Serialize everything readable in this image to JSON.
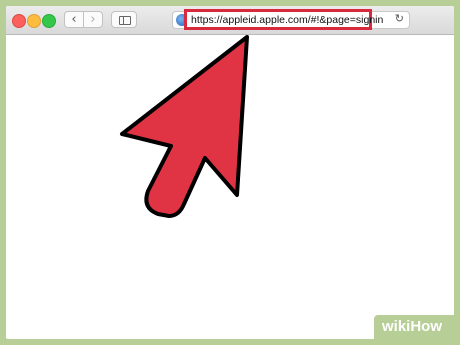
{
  "browser": {
    "url": "https://appleid.apple.com/#!&page=signin",
    "back_icon": "chevron-left",
    "forward_icon": "chevron-right",
    "reload_icon": "reload"
  },
  "watermark": {
    "text": "wikiHow"
  },
  "colors": {
    "arrow_fill": "#e03444",
    "highlight": "#d82a3f",
    "frame": "#b7cf97"
  }
}
